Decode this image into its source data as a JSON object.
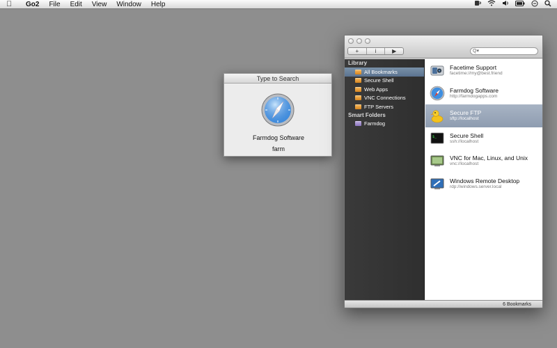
{
  "menubar": {
    "apple": "",
    "app_name": "Go2",
    "menus": [
      "File",
      "Edit",
      "View",
      "Window",
      "Help"
    ],
    "status_icons": [
      "coffee-icon",
      "wifi-icon",
      "volume-icon",
      "battery-icon",
      "clock-icon",
      "spotlight-icon"
    ]
  },
  "search_panel": {
    "title": "Type to Search",
    "result_name": "Farmdog Software",
    "query": "farm"
  },
  "main_window": {
    "toolbar": {
      "add_label": "+",
      "info_label": "i",
      "run_label": "▶",
      "search_placeholder": "Q▾"
    },
    "sidebar": {
      "library_heading": "Library",
      "library_items": [
        {
          "label": "All Bookmarks",
          "selected": true
        },
        {
          "label": "Secure Shell"
        },
        {
          "label": "Web Apps"
        },
        {
          "label": "VNC Connections"
        },
        {
          "label": "FTP Servers"
        }
      ],
      "smart_heading": "Smart Folders",
      "smart_items": [
        {
          "label": "Farmdog"
        }
      ]
    },
    "bookmarks": [
      {
        "title": "Facetime Support",
        "subtitle": "facetime://my@best.friend",
        "icon": "camera-icon"
      },
      {
        "title": "Farmdog Software",
        "subtitle": "http://farmdogapps.com",
        "icon": "safari-icon"
      },
      {
        "title": "Secure FTP",
        "subtitle": "sftp://localhost",
        "icon": "duck-icon",
        "selected": true
      },
      {
        "title": "Secure Shell",
        "subtitle": "ssh://localhost",
        "icon": "terminal-icon"
      },
      {
        "title": "VNC for Mac, Linux, and Unix",
        "subtitle": "vnc://localhost",
        "icon": "screen-sharing-icon"
      },
      {
        "title": "Windows Remote Desktop",
        "subtitle": "rdp://windows.server.local",
        "icon": "remote-desktop-icon"
      }
    ],
    "status": "6 Bookmarks"
  }
}
